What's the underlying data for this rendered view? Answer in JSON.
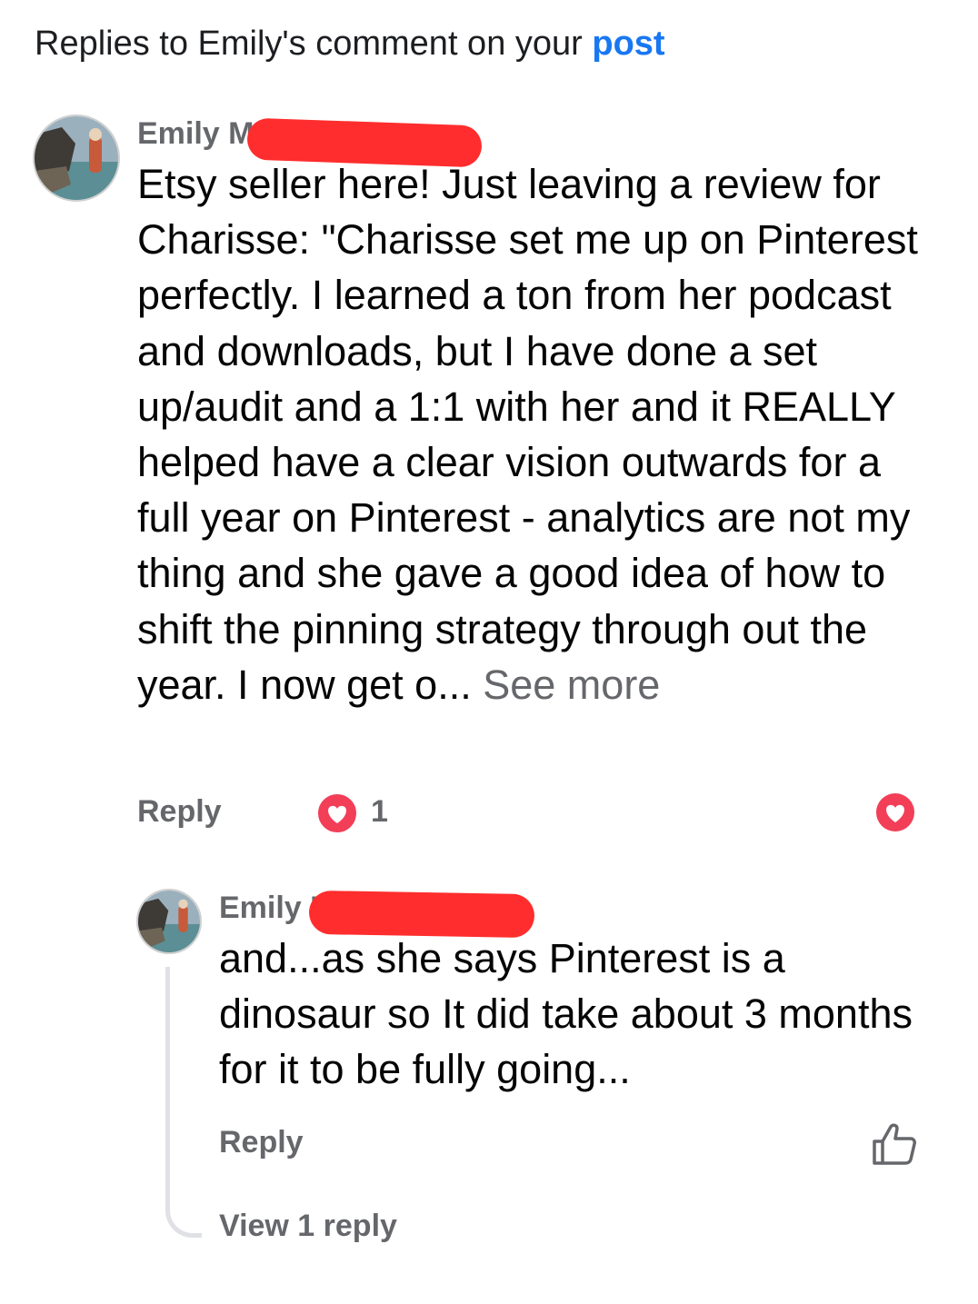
{
  "header": {
    "prefix": "Replies to Emily's comment on your ",
    "link": "post"
  },
  "comment": {
    "author": "Emily Mc",
    "text": "Etsy seller here!  Just leaving a review for Charisse: \"Charisse set me up on Pinterest perfectly. I learned a ton from her podcast and downloads, but I have done a set up/audit and a 1:1 with her and it REALLY helped have a clear vision outwards for a full year on Pinterest - analytics are not my thing and she gave a good idea of how to shift the pinning strategy through out the year. I now get o...",
    "see_more": "See more",
    "reply_label": "Reply",
    "reaction_count": "1",
    "avatar_icon": "profile-photo",
    "reaction_icon": "love-reaction-icon",
    "right_icon": "love-react-button-icon",
    "heart_color": "#f33e58"
  },
  "reply": {
    "author": "Emily M",
    "text": "and...as she says Pinterest is a dinosaur so It did take about 3 months for it to be fully going...",
    "reply_label": "Reply",
    "like_icon": "thumbs-up-icon",
    "view_replies": "View 1 reply"
  },
  "colors": {
    "link": "#1877f2",
    "secondary_text": "#65676b",
    "redaction": "#ff2d2d"
  }
}
